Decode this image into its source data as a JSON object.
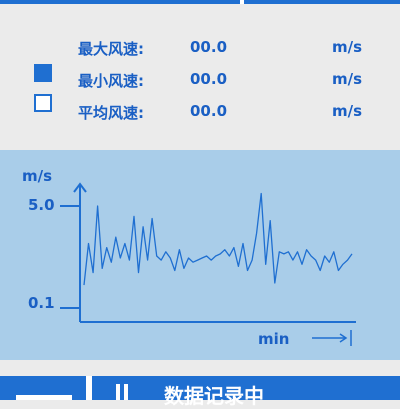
{
  "stats": {
    "max": {
      "label": "最大风速:",
      "value": "00.0",
      "unit": "m/s"
    },
    "min": {
      "label": "最小风速:",
      "value": "00.0",
      "unit": "m/s"
    },
    "avg": {
      "label": "平均风速:",
      "value": "00.0",
      "unit": "m/s"
    }
  },
  "legend": {
    "filled_icon": "square-filled-icon",
    "empty_icon": "square-outline-icon"
  },
  "chart_data": {
    "type": "line",
    "ylabel": "m/s",
    "xlabel": "min",
    "y_ticks": [
      "5.0",
      "0.1"
    ],
    "grid": false,
    "series": [
      {
        "values": [
          1.2,
          3.2,
          1.8,
          5.0,
          2.0,
          3.0,
          2.3,
          3.5,
          2.5,
          3.2,
          2.4,
          4.5,
          1.8,
          4.0,
          2.4,
          4.4,
          2.6,
          2.4,
          2.8,
          2.5,
          1.9,
          2.9,
          2.0,
          2.5,
          2.3,
          2.4,
          2.5,
          2.6,
          2.4,
          2.6,
          2.7,
          2.9,
          2.6,
          3.0,
          2.1,
          3.2,
          1.9,
          2.4,
          3.7,
          5.6,
          2.2,
          4.3,
          1.3,
          2.8,
          2.7,
          2.8,
          2.4,
          2.8,
          2.2,
          2.9,
          2.6,
          2.4,
          1.9,
          2.6,
          2.3,
          2.8,
          1.9,
          2.2,
          2.4,
          2.7
        ]
      }
    ],
    "line_color": "#1f6fd1"
  },
  "status": {
    "icon": "pause-icon",
    "text": "数据记录中"
  },
  "colors": {
    "accent": "#1f6fd1",
    "chart_bg": "#a9cde9",
    "panel_bg": "#ebebeb"
  }
}
